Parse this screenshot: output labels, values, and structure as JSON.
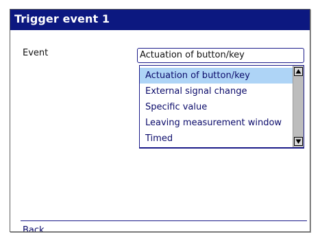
{
  "window": {
    "title": "Trigger event 1"
  },
  "event": {
    "label": "Event",
    "selected_value": "Actuation of button/key",
    "options": [
      "Actuation of button/key",
      "External signal change",
      "Specific value",
      "Leaving measurement window",
      "Timed"
    ],
    "highlighted_index": 0
  },
  "scrollbar": {
    "up_icon": "scroll-up-arrow",
    "down_icon": "scroll-down-arrow"
  },
  "footer": {
    "back_label": "Back"
  },
  "colors": {
    "titlebar": "#0c1880",
    "selection": "#aed4f6",
    "text_blue": "#0a0a6a"
  }
}
